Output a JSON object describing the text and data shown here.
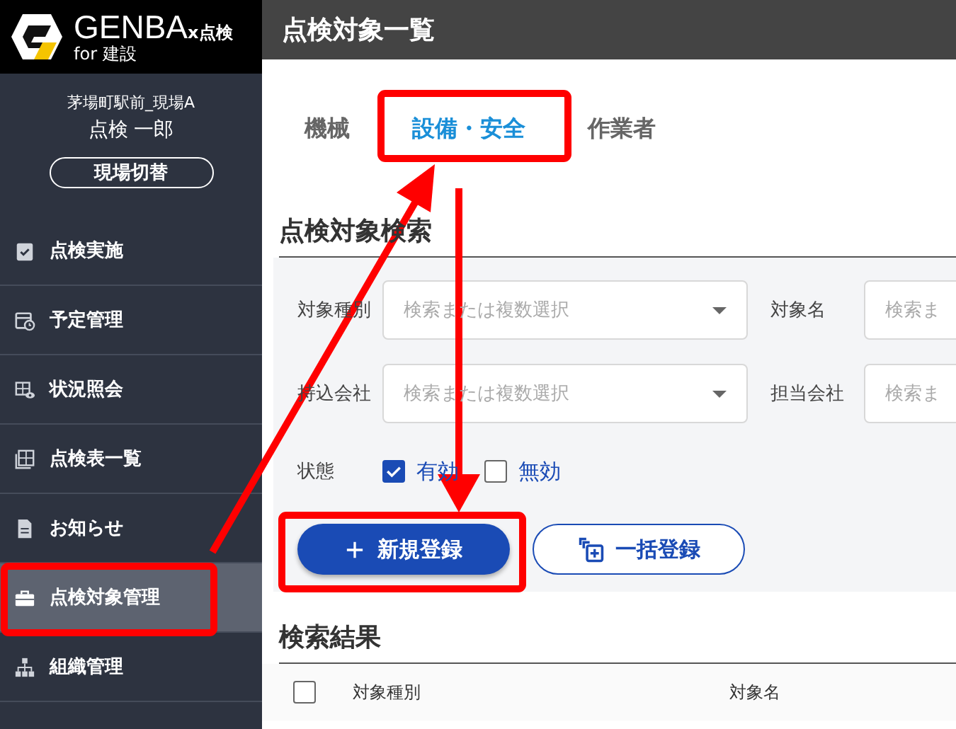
{
  "logo": {
    "title": "GENBA",
    "suffix": "x点検",
    "subtitle": "for 建設"
  },
  "user": {
    "site": "茅場町駅前_現場A",
    "name": "点検 一郎",
    "switch_button": "現場切替"
  },
  "sidebar": {
    "items": [
      {
        "label": "点検実施",
        "kind": "clipboard",
        "selected": false
      },
      {
        "label": "予定管理",
        "kind": "calendar",
        "selected": false
      },
      {
        "label": "状況照会",
        "kind": "viewer",
        "selected": false
      },
      {
        "label": "点検表一覧",
        "kind": "sheets",
        "selected": false
      },
      {
        "label": "お知らせ",
        "kind": "notice",
        "selected": false
      },
      {
        "label": "点検対象管理",
        "kind": "toolbox",
        "selected": true
      },
      {
        "label": "組織管理",
        "kind": "org",
        "selected": false
      }
    ]
  },
  "header": {
    "title": "点検対象一覧"
  },
  "tabs": [
    {
      "label": "機械",
      "selected": false
    },
    {
      "label": "設備・安全",
      "selected": true
    },
    {
      "label": "作業者",
      "selected": false
    }
  ],
  "search": {
    "title": "点検対象検索",
    "rows": [
      {
        "label": "対象種別",
        "placeholder": "検索または複数選択",
        "label_2": "対象名",
        "placeholder_2": "検索ま"
      },
      {
        "label": "持込会社",
        "placeholder": "検索または複数選択",
        "label_2": "担当会社",
        "placeholder_2": "検索ま"
      }
    ],
    "status_label": "状態",
    "status_options": [
      {
        "label": "有効",
        "checked": true
      },
      {
        "label": "無効",
        "checked": false
      }
    ],
    "new_button": "新規登録",
    "bulk_button": "一括登録"
  },
  "results": {
    "title": "検索結果",
    "columns": [
      "対象種別",
      "対象名"
    ],
    "all_checked": false
  }
}
